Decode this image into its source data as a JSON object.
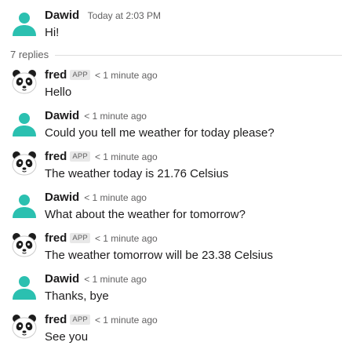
{
  "thread": {
    "parent": {
      "author": "Dawid",
      "time": "Today at 2:03 PM",
      "text": "Hi!"
    },
    "replies_label": "7 replies",
    "replies": [
      {
        "author": "fred",
        "badge": "APP",
        "time": "< 1 minute ago",
        "text": "Hello",
        "avatar": "panda-avatar-icon"
      },
      {
        "author": "Dawid",
        "badge": "",
        "time": "< 1 minute ago",
        "text": "Could you tell me weather for today please?",
        "avatar": "user-avatar-icon"
      },
      {
        "author": "fred",
        "badge": "APP",
        "time": "< 1 minute ago",
        "text": "The weather today is 21.76 Celsius",
        "avatar": "panda-avatar-icon"
      },
      {
        "author": "Dawid",
        "badge": "",
        "time": "< 1 minute ago",
        "text": "What about the weather for tomorrow?",
        "avatar": "user-avatar-icon"
      },
      {
        "author": "fred",
        "badge": "APP",
        "time": "< 1 minute ago",
        "text": "The weather tomorrow will be 23.38 Celsius",
        "avatar": "panda-avatar-icon"
      },
      {
        "author": "Dawid",
        "badge": "",
        "time": "< 1 minute ago",
        "text": "Thanks, bye",
        "avatar": "user-avatar-icon"
      },
      {
        "author": "fred",
        "badge": "APP",
        "time": "< 1 minute ago",
        "text": "See you",
        "avatar": "panda-avatar-icon"
      }
    ]
  },
  "colors": {
    "user_avatar": "#2bc0b0",
    "text": "#1d1c1d",
    "muted": "#616061",
    "divider": "#dddddd",
    "badge_bg": "#e8e8e8"
  }
}
